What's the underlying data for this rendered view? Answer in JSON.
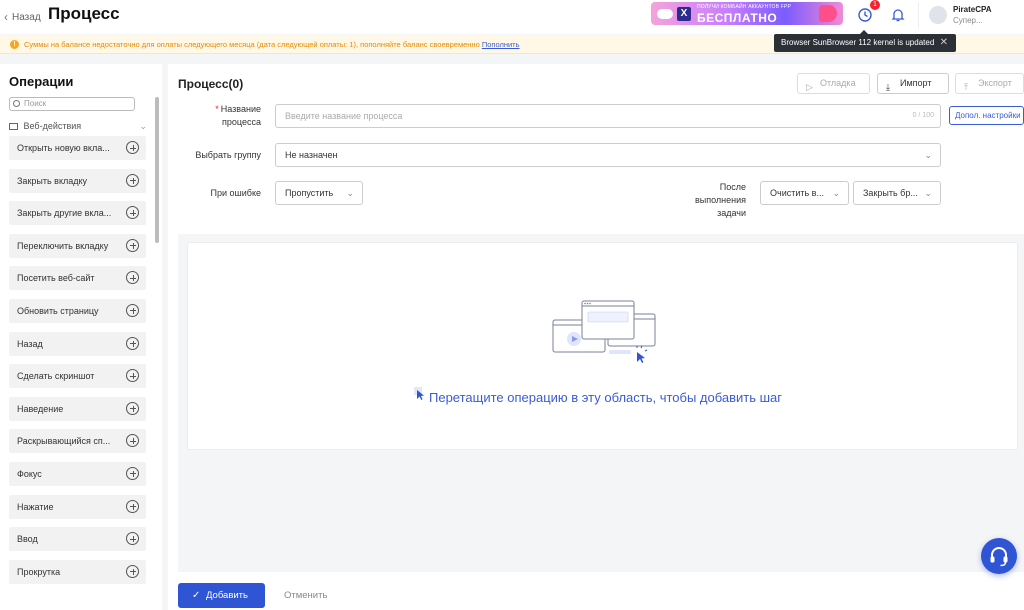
{
  "header": {
    "back_label": "Назад",
    "page_title": "Процесс",
    "promo_top": "ПОЛУЧИ КОМБАЙН АККАУНТОВ FPP",
    "promo_big": "БЕСПЛАТНО",
    "promo_logo": "X",
    "notification_count": "1",
    "user_name": "PirateCPA",
    "user_role": "Супер..."
  },
  "tooltip": {
    "text": "Browser SunBrowser 112 kernel is updated",
    "close": "✕"
  },
  "warning": {
    "text": "Суммы на балансе недостаточно для оплаты следующего месяца (дата следующей оплаты: 1), пополняйте баланс своевременно",
    "link": "Пополнить"
  },
  "sidebar": {
    "title": "Операции",
    "search_placeholder": "Поиск",
    "group_label": "Веб-действия",
    "items": [
      "Открыть новую вкла...",
      "Закрыть вкладку",
      "Закрыть другие вкла...",
      "Переключить вкладку",
      "Посетить веб-сайт",
      "Обновить страницу",
      "Назад",
      "Сделать скриншот",
      "Наведение",
      "Раскрывающийся сп...",
      "Фокус",
      "Нажатие",
      "Ввод",
      "Прокрутка"
    ]
  },
  "main": {
    "title": "Процесс(0)",
    "debug_label": "Отладка",
    "import_label": "Импорт",
    "export_label": "Экспорт",
    "name_label_1": "Название",
    "name_label_2": "процесса",
    "name_placeholder": "Введите название процесса",
    "name_counter": "0 / 100",
    "advanced_label": "Допол. настройки",
    "group_label": "Выбрать группу",
    "group_value": "Не назначен",
    "on_error_label": "При ошибке",
    "on_error_value": "Пропустить",
    "after_label_1": "После",
    "after_label_2": "выполнения",
    "after_label_3": "задачи",
    "after_value_1": "Очистить в...",
    "after_value_2": "Закрыть бр...",
    "drop_hint": "Перетащите операцию в эту область, чтобы добавить шаг",
    "add_label": "Добавить",
    "cancel_label": "Отменить"
  },
  "colors": {
    "accent": "#2f55d4",
    "warning": "#e58a00",
    "badge": "#f5222d"
  }
}
